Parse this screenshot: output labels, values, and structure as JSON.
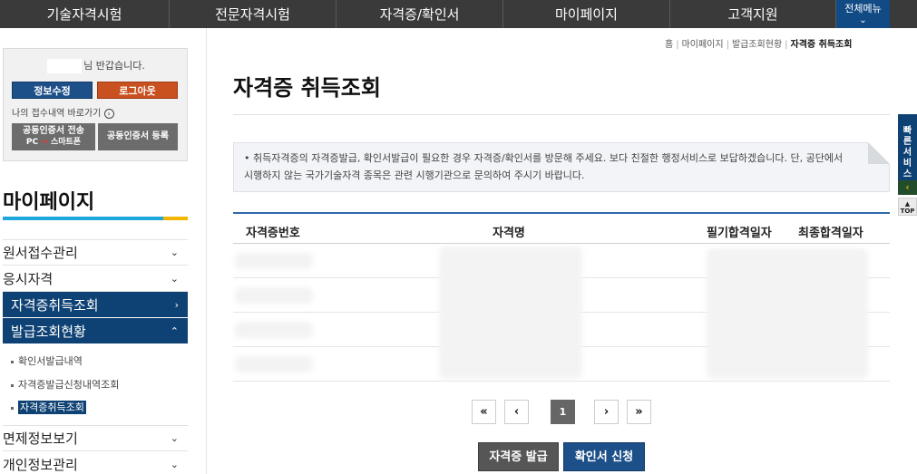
{
  "topnav": {
    "items": [
      "기술자격시험",
      "전문자격시험",
      "자격증/확인서",
      "마이페이지",
      "고객지원"
    ],
    "all_menu_label": "전체메뉴"
  },
  "sidebar": {
    "greeting_suffix": "님 반갑습니다.",
    "edit_info_label": "정보수정",
    "logout_label": "로그아웃",
    "shortcut_label": "나의 접수내역 바로가기",
    "cert_send_label": "공동인증서 전송",
    "cert_send_sub_pc": "PC",
    "cert_send_sub_phone": "스마트폰",
    "cert_register_label": "공동인증서 등록",
    "title": "마이페이지",
    "menu": [
      {
        "label": "원서접수관리",
        "arrow": "⌄"
      },
      {
        "label": "응시자격",
        "arrow": "⌄"
      },
      {
        "label": "자격증취득조회",
        "arrow": "›"
      },
      {
        "label": "발급조회현황",
        "arrow": "⌃"
      }
    ],
    "submenu": [
      "확인서발급내역",
      "자격증발급신청내역조회",
      "자격증취득조회"
    ],
    "menu_bottom": [
      {
        "label": "면제정보보기",
        "arrow": "⌄"
      },
      {
        "label": "개인정보관리",
        "arrow": "⌄"
      }
    ]
  },
  "breadcrumb": [
    "홈",
    "마이페이지",
    "발급조회현황",
    "자격증 취득조회"
  ],
  "main": {
    "title": "자격증 취득조회",
    "notice": "취득자격증의 자격증발급, 확인서발급이 필요한 경우 자격증/확인서를 방문해 주세요. 보다 친절한 행정서비스로 보답하겠습니다. 단, 공단에서 시행하지 않는 국가기술자격 종목은 관련 시행기관으로 문의하여 주시기 바랍니다.",
    "table_headers": [
      "자격증번호",
      "자격명",
      "필기합격일자",
      "최종합격일자"
    ],
    "pagination": {
      "first": "«",
      "prev": "‹",
      "current": "1",
      "next": "›",
      "last": "»"
    },
    "btn_cert_issue": "자격증 발급",
    "btn_confirm_apply": "확인서 신청"
  },
  "quick": {
    "label": "빠른서비스",
    "top_label": "TOP"
  }
}
